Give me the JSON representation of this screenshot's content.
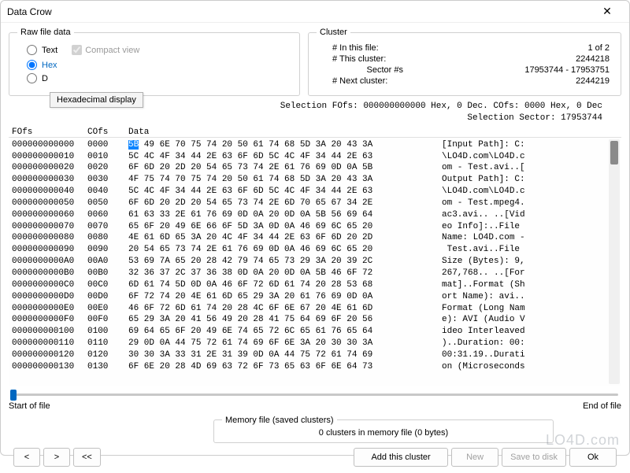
{
  "window": {
    "title": "Data Crow"
  },
  "raw": {
    "legend": "Raw file data",
    "text_label": "Text",
    "compact_label": "Compact view",
    "hex_label": "Hex",
    "d_label": "D",
    "tooltip": "Hexadecimal display"
  },
  "cluster": {
    "legend": "Cluster",
    "lab_in_file": "# In this file:",
    "val_in_file": "1 of 2",
    "lab_this": "# This cluster:",
    "val_this": "2244218",
    "lab_sector": "Sector #s",
    "val_sector": "17953744 - 17953751",
    "lab_next": "# Next cluster:",
    "val_next": "2244219"
  },
  "sel_line1": "Selection FOfs: 000000000000 Hex, 0 Dec.  COfs: 0000 Hex,  0 Dec",
  "sel_line2": "Selection Sector: 17953744",
  "hex_headers": {
    "c1": "FOfs",
    "c2": "COfs",
    "c3": "Data"
  },
  "rows": [
    {
      "ofs": "000000000000",
      "cofs": "0000",
      "first": "5B",
      "rest": " 49 6E 70 75 74 20 50 61 74 68 5D 3A 20 43 3A",
      "ascii": "[Input Path]: C:"
    },
    {
      "ofs": "000000000010",
      "cofs": "0010",
      "first": "",
      "rest": "5C 4C 4F 34 44 2E 63 6F 6D 5C 4C 4F 34 44 2E 63",
      "ascii": "\\LO4D.com\\LO4D.c"
    },
    {
      "ofs": "000000000020",
      "cofs": "0020",
      "first": "",
      "rest": "6F 6D 20 2D 20 54 65 73 74 2E 61 76 69 0D 0A 5B",
      "ascii": "om - Test.avi..["
    },
    {
      "ofs": "000000000030",
      "cofs": "0030",
      "first": "",
      "rest": "4F 75 74 70 75 74 20 50 61 74 68 5D 3A 20 43 3A",
      "ascii": "Output Path]: C:"
    },
    {
      "ofs": "000000000040",
      "cofs": "0040",
      "first": "",
      "rest": "5C 4C 4F 34 44 2E 63 6F 6D 5C 4C 4F 34 44 2E 63",
      "ascii": "\\LO4D.com\\LO4D.c"
    },
    {
      "ofs": "000000000050",
      "cofs": "0050",
      "first": "",
      "rest": "6F 6D 20 2D 20 54 65 73 74 2E 6D 70 65 67 34 2E",
      "ascii": "om - Test.mpeg4."
    },
    {
      "ofs": "000000000060",
      "cofs": "0060",
      "first": "",
      "rest": "61 63 33 2E 61 76 69 0D 0A 20 0D 0A 5B 56 69 64",
      "ascii": "ac3.avi.. ..[Vid"
    },
    {
      "ofs": "000000000070",
      "cofs": "0070",
      "first": "",
      "rest": "65 6F 20 49 6E 66 6F 5D 3A 0D 0A 46 69 6C 65 20",
      "ascii": "eo Info]:..File "
    },
    {
      "ofs": "000000000080",
      "cofs": "0080",
      "first": "",
      "rest": "4E 61 6D 65 3A 20 4C 4F 34 44 2E 63 6F 6D 20 2D",
      "ascii": "Name: LO4D.com -"
    },
    {
      "ofs": "000000000090",
      "cofs": "0090",
      "first": "",
      "rest": "20 54 65 73 74 2E 61 76 69 0D 0A 46 69 6C 65 20",
      "ascii": " Test.avi..File "
    },
    {
      "ofs": "0000000000A0",
      "cofs": "00A0",
      "first": "",
      "rest": "53 69 7A 65 20 28 42 79 74 65 73 29 3A 20 39 2C",
      "ascii": "Size (Bytes): 9,"
    },
    {
      "ofs": "0000000000B0",
      "cofs": "00B0",
      "first": "",
      "rest": "32 36 37 2C 37 36 38 0D 0A 20 0D 0A 5B 46 6F 72",
      "ascii": "267,768.. ..[For"
    },
    {
      "ofs": "0000000000C0",
      "cofs": "00C0",
      "first": "",
      "rest": "6D 61 74 5D 0D 0A 46 6F 72 6D 61 74 20 28 53 68",
      "ascii": "mat]..Format (Sh"
    },
    {
      "ofs": "0000000000D0",
      "cofs": "00D0",
      "first": "",
      "rest": "6F 72 74 20 4E 61 6D 65 29 3A 20 61 76 69 0D 0A",
      "ascii": "ort Name): avi.."
    },
    {
      "ofs": "0000000000E0",
      "cofs": "00E0",
      "first": "",
      "rest": "46 6F 72 6D 61 74 20 28 4C 6F 6E 67 20 4E 61 6D",
      "ascii": "Format (Long Nam"
    },
    {
      "ofs": "0000000000F0",
      "cofs": "00F0",
      "first": "",
      "rest": "65 29 3A 20 41 56 49 20 28 41 75 64 69 6F 20 56",
      "ascii": "e): AVI (Audio V"
    },
    {
      "ofs": "000000000100",
      "cofs": "0100",
      "first": "",
      "rest": "69 64 65 6F 20 49 6E 74 65 72 6C 65 61 76 65 64",
      "ascii": "ideo Interleaved"
    },
    {
      "ofs": "000000000110",
      "cofs": "0110",
      "first": "",
      "rest": "29 0D 0A 44 75 72 61 74 69 6F 6E 3A 20 30 30 3A",
      "ascii": ")..Duration: 00:"
    },
    {
      "ofs": "000000000120",
      "cofs": "0120",
      "first": "",
      "rest": "30 30 3A 33 31 2E 31 39 0D 0A 44 75 72 61 74 69",
      "ascii": "00:31.19..Durati"
    },
    {
      "ofs": "000000000130",
      "cofs": "0130",
      "first": "",
      "rest": "6F 6E 20 28 4D 69 63 72 6F 73 65 63 6F 6E 64 73",
      "ascii": "on (Microseconds"
    }
  ],
  "slider": {
    "start": "Start of file",
    "end": "End of file"
  },
  "memory": {
    "legend": "Memory file (saved clusters)",
    "text": "0 clusters in memory file (0 bytes)"
  },
  "buttons": {
    "prev": "<",
    "next": ">",
    "rewind": "<<",
    "add": "Add this cluster",
    "new": "New",
    "save": "Save to disk",
    "ok": "Ok"
  },
  "watermark": "LO4D.com"
}
